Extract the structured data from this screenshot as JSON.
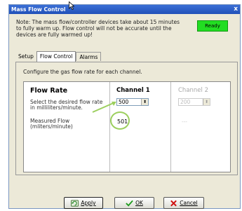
{
  "window": {
    "title": "Mass Flow Control",
    "close": "x"
  },
  "note": "Note: The mass flow/controller devices take about 15 minutes to fully warm up. Flow control will not be accurate until the devices are fully warmed up!",
  "status_badge": "Ready",
  "tabs": [
    {
      "label": "Setup",
      "active": false
    },
    {
      "label": "Flow Control",
      "active": true
    },
    {
      "label": "Alarms",
      "active": false
    }
  ],
  "panel": {
    "description": "Configure the gas flow rate for each channel.",
    "table": {
      "header_label": "Flow Rate",
      "channel1_label": "Channel 1",
      "channel2_label": "Channel 2",
      "setpoint_label": "Select the desired flow rate in milliliters/minute.",
      "measured_label": "Measured Flow (mliters/minute)",
      "channel1_setpoint": "500",
      "channel2_setpoint": "200",
      "channel1_measured": "501",
      "channel2_measured": "---"
    }
  },
  "buttons": {
    "apply": "Apply",
    "ok": "OK",
    "cancel": "Cancel"
  },
  "colors": {
    "ready": "#22dd22",
    "titlebar": "#2151b8",
    "annotation": "#9ccf5e"
  }
}
